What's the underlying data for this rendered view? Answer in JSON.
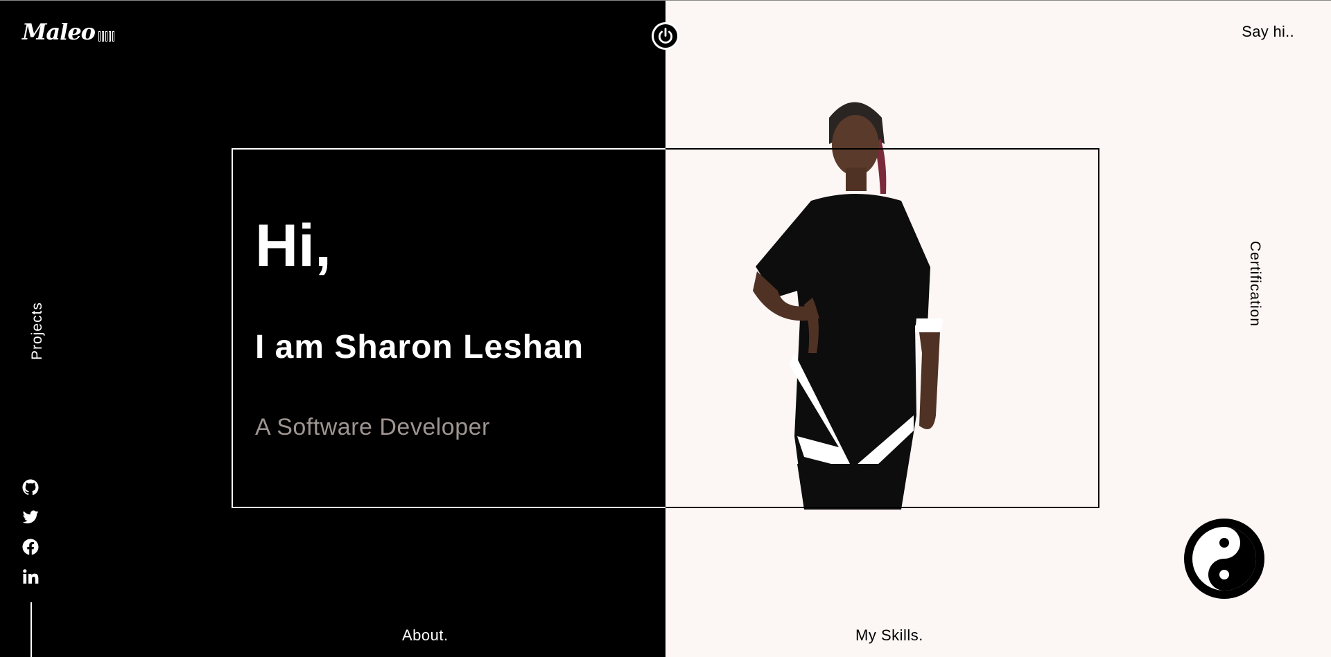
{
  "logo": {
    "text": "Maleo",
    "bar_count": 5
  },
  "header": {
    "say_hi_label": "Say hi.."
  },
  "nav": {
    "projects_label": "Projects",
    "certification_label": "Certification",
    "about_label": "About.",
    "skills_label": "My Skills."
  },
  "hero": {
    "greeting": "Hi,",
    "name": "I am Sharon Leshan",
    "role": "A Software Developer"
  },
  "social": [
    {
      "icon": "github-icon"
    },
    {
      "icon": "twitter-icon"
    },
    {
      "icon": "facebook-icon"
    },
    {
      "icon": "linkedin-icon"
    }
  ],
  "colors": {
    "dark_bg": "#000000",
    "light_bg": "#fcf6f4",
    "role_text": "#9e9591"
  }
}
